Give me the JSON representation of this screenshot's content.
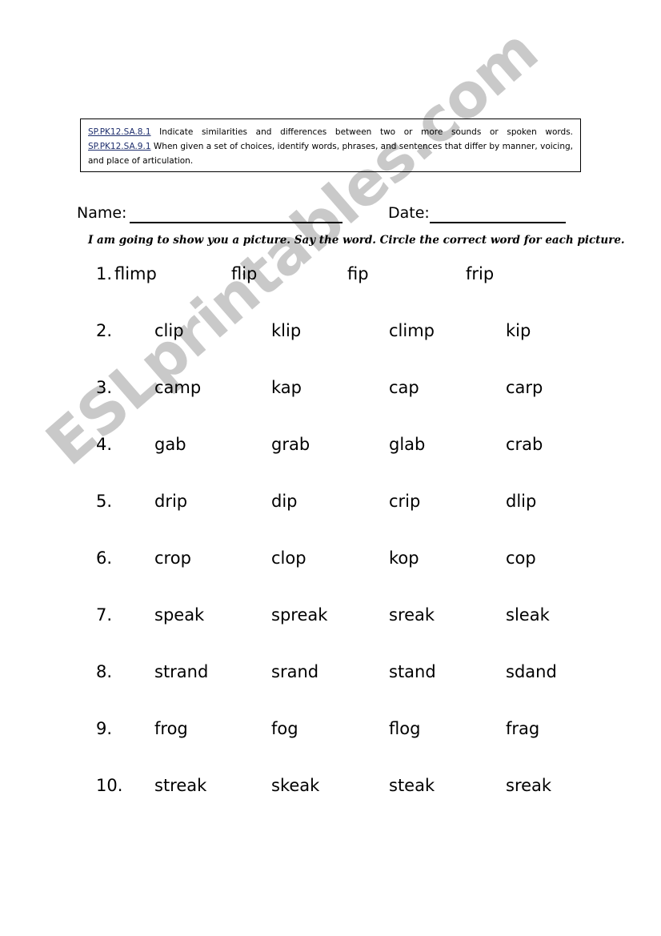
{
  "watermark": {
    "text": "ESLprintables.com",
    "color": "#c9c9c9"
  },
  "standards": {
    "items": [
      {
        "code": "SP.PK12.SA.8.1",
        "text": "Indicate similarities and differences between two or more sounds or spoken words."
      },
      {
        "code": "SP.PK12.SA.9.1",
        "text": "When given a set of choices, identify words, phrases, and sentences that differ by manner, voicing, and place of articulation."
      }
    ],
    "code_color": "#1f2f6e"
  },
  "header": {
    "name_label": "Name:",
    "name_value": "",
    "name_placeholder": "",
    "date_label": "Date:",
    "date_value": "",
    "date_placeholder": ""
  },
  "instruction": "I am going to show you a picture.  Say the word.  Circle the correct word for each picture.",
  "worksheet": {
    "rows": [
      {
        "number": "1.",
        "words": [
          "flimp",
          "flip",
          "fip",
          "frip"
        ]
      },
      {
        "number": "2.",
        "words": [
          "clip",
          "klip",
          "climp",
          "kip"
        ]
      },
      {
        "number": "3.",
        "words": [
          "camp",
          "kap",
          "cap",
          "carp"
        ]
      },
      {
        "number": "4.",
        "words": [
          "gab",
          "grab",
          "glab",
          "crab"
        ]
      },
      {
        "number": "5.",
        "words": [
          "drip",
          "dip",
          "crip",
          "dlip"
        ]
      },
      {
        "number": "6.",
        "words": [
          "crop",
          "clop",
          "kop",
          "cop"
        ]
      },
      {
        "number": "7.",
        "words": [
          "speak",
          "spreak",
          "sreak",
          "sleak"
        ]
      },
      {
        "number": "8.",
        "words": [
          "strand",
          "srand",
          "stand",
          "sdand"
        ]
      },
      {
        "number": "9.",
        "words": [
          "frog",
          "fog",
          "flog",
          "frag"
        ]
      },
      {
        "number": "10.",
        "words": [
          "streak",
          "skeak",
          "steak",
          "sreak"
        ]
      }
    ]
  }
}
